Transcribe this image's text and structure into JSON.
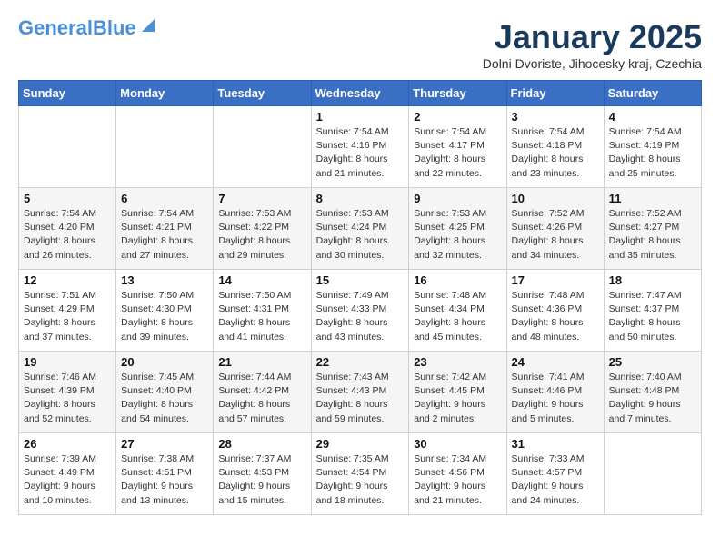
{
  "header": {
    "logo_general": "General",
    "logo_blue": "Blue",
    "month_title": "January 2025",
    "location": "Dolni Dvoriste, Jihocesky kraj, Czechia"
  },
  "weekdays": [
    "Sunday",
    "Monday",
    "Tuesday",
    "Wednesday",
    "Thursday",
    "Friday",
    "Saturday"
  ],
  "weeks": [
    [
      {
        "day": "",
        "info": ""
      },
      {
        "day": "",
        "info": ""
      },
      {
        "day": "",
        "info": ""
      },
      {
        "day": "1",
        "info": "Sunrise: 7:54 AM\nSunset: 4:16 PM\nDaylight: 8 hours and 21 minutes."
      },
      {
        "day": "2",
        "info": "Sunrise: 7:54 AM\nSunset: 4:17 PM\nDaylight: 8 hours and 22 minutes."
      },
      {
        "day": "3",
        "info": "Sunrise: 7:54 AM\nSunset: 4:18 PM\nDaylight: 8 hours and 23 minutes."
      },
      {
        "day": "4",
        "info": "Sunrise: 7:54 AM\nSunset: 4:19 PM\nDaylight: 8 hours and 25 minutes."
      }
    ],
    [
      {
        "day": "5",
        "info": "Sunrise: 7:54 AM\nSunset: 4:20 PM\nDaylight: 8 hours and 26 minutes."
      },
      {
        "day": "6",
        "info": "Sunrise: 7:54 AM\nSunset: 4:21 PM\nDaylight: 8 hours and 27 minutes."
      },
      {
        "day": "7",
        "info": "Sunrise: 7:53 AM\nSunset: 4:22 PM\nDaylight: 8 hours and 29 minutes."
      },
      {
        "day": "8",
        "info": "Sunrise: 7:53 AM\nSunset: 4:24 PM\nDaylight: 8 hours and 30 minutes."
      },
      {
        "day": "9",
        "info": "Sunrise: 7:53 AM\nSunset: 4:25 PM\nDaylight: 8 hours and 32 minutes."
      },
      {
        "day": "10",
        "info": "Sunrise: 7:52 AM\nSunset: 4:26 PM\nDaylight: 8 hours and 34 minutes."
      },
      {
        "day": "11",
        "info": "Sunrise: 7:52 AM\nSunset: 4:27 PM\nDaylight: 8 hours and 35 minutes."
      }
    ],
    [
      {
        "day": "12",
        "info": "Sunrise: 7:51 AM\nSunset: 4:29 PM\nDaylight: 8 hours and 37 minutes."
      },
      {
        "day": "13",
        "info": "Sunrise: 7:50 AM\nSunset: 4:30 PM\nDaylight: 8 hours and 39 minutes."
      },
      {
        "day": "14",
        "info": "Sunrise: 7:50 AM\nSunset: 4:31 PM\nDaylight: 8 hours and 41 minutes."
      },
      {
        "day": "15",
        "info": "Sunrise: 7:49 AM\nSunset: 4:33 PM\nDaylight: 8 hours and 43 minutes."
      },
      {
        "day": "16",
        "info": "Sunrise: 7:48 AM\nSunset: 4:34 PM\nDaylight: 8 hours and 45 minutes."
      },
      {
        "day": "17",
        "info": "Sunrise: 7:48 AM\nSunset: 4:36 PM\nDaylight: 8 hours and 48 minutes."
      },
      {
        "day": "18",
        "info": "Sunrise: 7:47 AM\nSunset: 4:37 PM\nDaylight: 8 hours and 50 minutes."
      }
    ],
    [
      {
        "day": "19",
        "info": "Sunrise: 7:46 AM\nSunset: 4:39 PM\nDaylight: 8 hours and 52 minutes."
      },
      {
        "day": "20",
        "info": "Sunrise: 7:45 AM\nSunset: 4:40 PM\nDaylight: 8 hours and 54 minutes."
      },
      {
        "day": "21",
        "info": "Sunrise: 7:44 AM\nSunset: 4:42 PM\nDaylight: 8 hours and 57 minutes."
      },
      {
        "day": "22",
        "info": "Sunrise: 7:43 AM\nSunset: 4:43 PM\nDaylight: 8 hours and 59 minutes."
      },
      {
        "day": "23",
        "info": "Sunrise: 7:42 AM\nSunset: 4:45 PM\nDaylight: 9 hours and 2 minutes."
      },
      {
        "day": "24",
        "info": "Sunrise: 7:41 AM\nSunset: 4:46 PM\nDaylight: 9 hours and 5 minutes."
      },
      {
        "day": "25",
        "info": "Sunrise: 7:40 AM\nSunset: 4:48 PM\nDaylight: 9 hours and 7 minutes."
      }
    ],
    [
      {
        "day": "26",
        "info": "Sunrise: 7:39 AM\nSunset: 4:49 PM\nDaylight: 9 hours and 10 minutes."
      },
      {
        "day": "27",
        "info": "Sunrise: 7:38 AM\nSunset: 4:51 PM\nDaylight: 9 hours and 13 minutes."
      },
      {
        "day": "28",
        "info": "Sunrise: 7:37 AM\nSunset: 4:53 PM\nDaylight: 9 hours and 15 minutes."
      },
      {
        "day": "29",
        "info": "Sunrise: 7:35 AM\nSunset: 4:54 PM\nDaylight: 9 hours and 18 minutes."
      },
      {
        "day": "30",
        "info": "Sunrise: 7:34 AM\nSunset: 4:56 PM\nDaylight: 9 hours and 21 minutes."
      },
      {
        "day": "31",
        "info": "Sunrise: 7:33 AM\nSunset: 4:57 PM\nDaylight: 9 hours and 24 minutes."
      },
      {
        "day": "",
        "info": ""
      }
    ]
  ]
}
